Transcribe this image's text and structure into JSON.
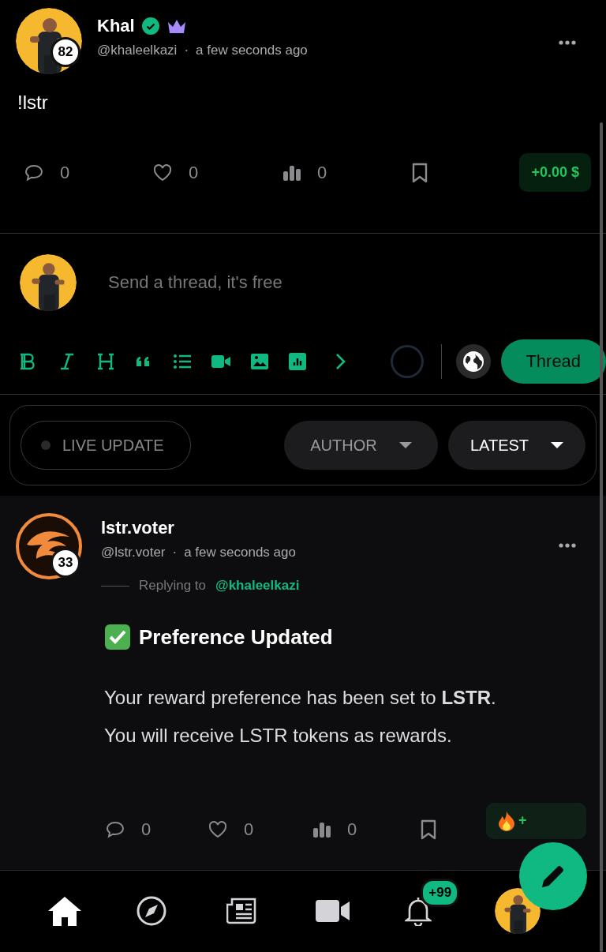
{
  "post": {
    "author": "Khal",
    "verified": true,
    "premium": true,
    "handle": "@khaleelkazi",
    "separator": "·",
    "time": "a few seconds ago",
    "reputation": "82",
    "body": "!lstr",
    "stats": {
      "comments": "0",
      "likes": "0",
      "views": "0"
    },
    "reward": "+0.00 $"
  },
  "composer": {
    "placeholder": "Send a thread, it's free",
    "submit": "Thread"
  },
  "filters": {
    "live_update": {
      "label": "LIVE UPDATE",
      "on": false
    },
    "dropdowns": [
      {
        "label": "AUTHOR",
        "selected": false
      },
      {
        "label": "LATEST",
        "selected": true
      }
    ]
  },
  "reply": {
    "author": "lstr.voter",
    "handle": "@lstr.voter",
    "separator": "·",
    "time": "a few seconds ago",
    "reputation": "33",
    "replying_label": "Replying to",
    "replying_to": "@khaleelkazi",
    "title": "Preference Updated",
    "body": [
      "Your reward preference has been set to **LSTR**.",
      "You will receive LSTR tokens as rewards."
    ],
    "stats": {
      "comments": "0",
      "likes": "0",
      "views": "0"
    },
    "reward": "+"
  },
  "nav": {
    "items": [
      {
        "kind": "home",
        "selected": true
      },
      {
        "kind": "explore",
        "selected": false
      },
      {
        "kind": "news",
        "selected": false
      },
      {
        "kind": "video",
        "selected": false
      },
      {
        "kind": "notifications",
        "selected": false,
        "badge": "+99"
      },
      {
        "kind": "profile",
        "selected": false
      }
    ]
  }
}
